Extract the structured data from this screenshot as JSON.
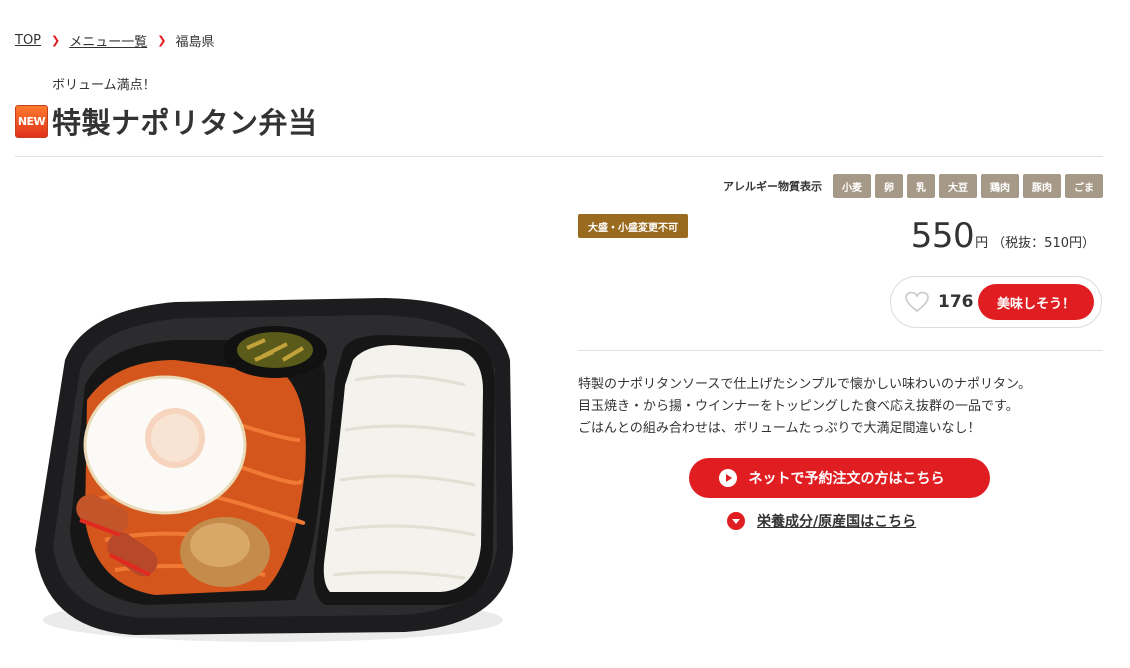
{
  "breadcrumb": {
    "items": [
      "TOP",
      "メニュー一覧"
    ],
    "current": "福島県"
  },
  "product": {
    "catch": "ボリューム満点！",
    "new_badge": "NEW",
    "title": "特製ナポリタン弁当",
    "size_note": "大盛・小盛変更不可",
    "price": "550",
    "price_unit": "円",
    "price_tax": "（税抜：510円）",
    "description": [
      "特製のナポリタンソースで仕上げたシンプルで懐かしい味わいのナポリタン。",
      "目玉焼き・から揚・ウインナーをトッピングした食べ応え抜群の一品です。",
      "ごはんとの組み合わせは、ボリュームたっぷりで大満足間違いなし！"
    ]
  },
  "allergy": {
    "label": "アレルギー物質表示",
    "tags": [
      "小麦",
      "卵",
      "乳",
      "大豆",
      "鶏肉",
      "豚肉",
      "ごま"
    ]
  },
  "like": {
    "count": "176",
    "button_label": "美味しそう！"
  },
  "actions": {
    "order_label": "ネットで予約注文の方はこちら",
    "nutrition_label": "栄養成分/原産国はこちら"
  },
  "colors": {
    "accent_red": "#e01e22",
    "allergy_tag": "#a79987",
    "size_badge": "#9a6b1e"
  },
  "icons": [
    "chevron-right-icon",
    "heart-icon",
    "play-icon",
    "chevron-down-icon"
  ]
}
